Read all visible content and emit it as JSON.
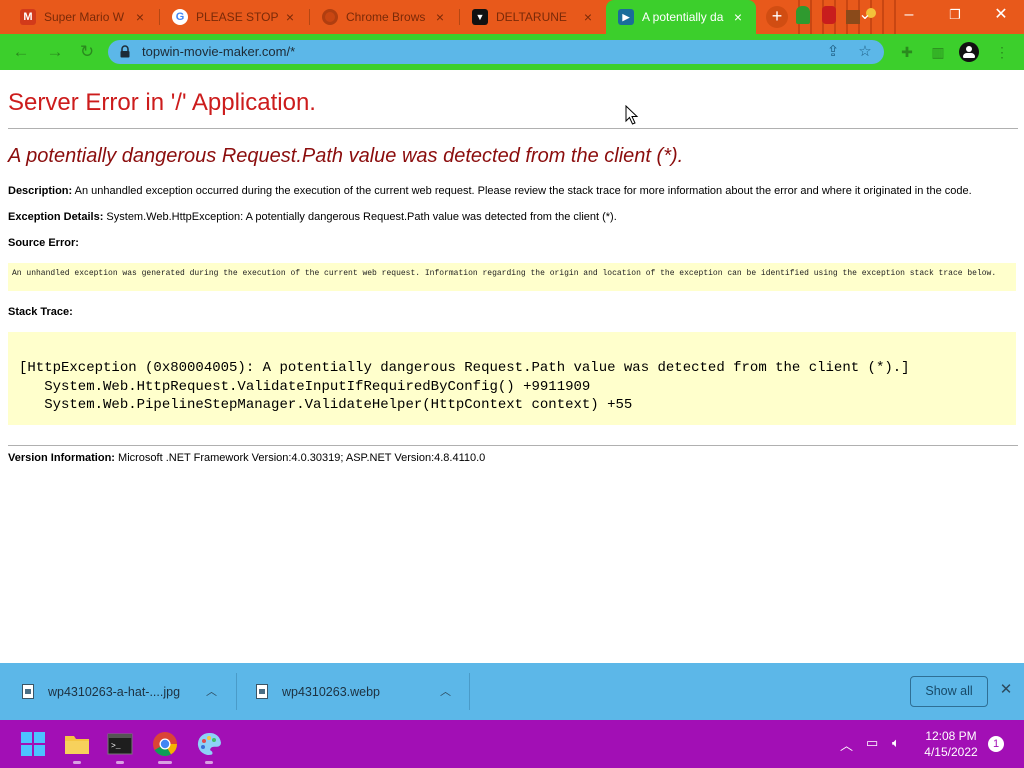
{
  "browser": {
    "tabs": [
      {
        "title": "Super Mario W",
        "icon": "mario-icon"
      },
      {
        "title": "PLEASE STOP",
        "icon": "google-icon"
      },
      {
        "title": "Chrome Brows",
        "icon": "chrome-icon"
      },
      {
        "title": "DELTARUNE",
        "icon": "deltarune-icon"
      },
      {
        "title": "A potentially da",
        "icon": "clapperboard-icon"
      }
    ],
    "new_tab_label": "+",
    "url": "topwin-movie-maker.com/*",
    "colors": {
      "tab_strip": "#e8591b",
      "toolbar": "#3ccf2c",
      "omnibox": "#5cb7e8"
    }
  },
  "error_page": {
    "title": "Server Error in '/' Application.",
    "subtitle": "A potentially dangerous Request.Path value was detected from the client (*).",
    "description_label": "Description:",
    "description_text": "An unhandled exception occurred during the execution of the current web request. Please review the stack trace for more information about the error and where it originated in the code.",
    "exception_label": "Exception Details:",
    "exception_text": "System.Web.HttpException: A potentially dangerous Request.Path value was detected from the client (*).",
    "source_error_label": "Source Error:",
    "source_error_text": "An unhandled exception was generated during the execution of the current web request. Information regarding the origin and location of the exception can be identified using the exception stack trace below.",
    "stack_trace_label": "Stack Trace:",
    "stack_trace": [
      "[HttpException (0x80004005): A potentially dangerous Request.Path value was detected from the client (*).]",
      "   System.Web.HttpRequest.ValidateInputIfRequiredByConfig() +9911909",
      "   System.Web.PipelineStepManager.ValidateHelper(HttpContext context) +55"
    ],
    "version_label": "Version Information:",
    "version_text": "Microsoft .NET Framework Version:4.0.30319; ASP.NET Version:4.8.4110.0"
  },
  "downloads": {
    "items": [
      {
        "name": "wp4310263-a-hat-....jpg"
      },
      {
        "name": "wp4310263.webp"
      }
    ],
    "show_all_label": "Show all"
  },
  "taskbar": {
    "apps": [
      "windows-start-icon",
      "file-explorer-icon",
      "terminal-icon",
      "chrome-icon",
      "paint-icon"
    ],
    "time": "12:08 PM",
    "date": "4/15/2022",
    "notification_count": "1",
    "color": "#a20fb5"
  }
}
